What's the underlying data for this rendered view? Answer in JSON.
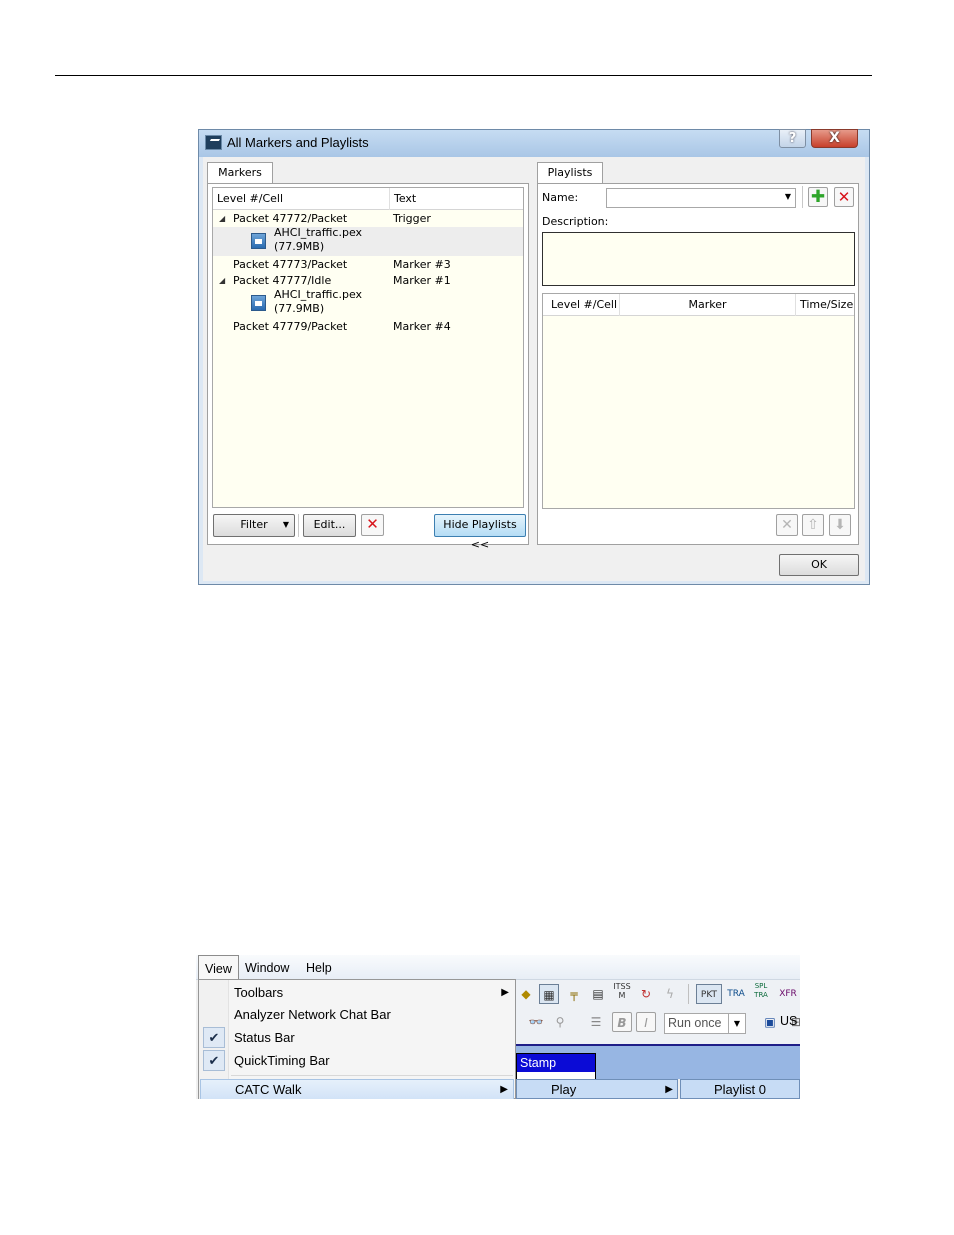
{
  "dialog": {
    "title": "All Markers and Playlists",
    "help_glyph": "?",
    "close_glyph": "X",
    "ok_label": "OK"
  },
  "markers": {
    "tab_label": "Markers",
    "columns": [
      "Level #/Cell",
      "Text"
    ],
    "rows": [
      {
        "expander": "◢",
        "cell": "Packet 47772/Packet",
        "text": "Trigger"
      },
      {
        "file_line1": "AHCI_traffic.pex",
        "file_line2": "(77.9MB)"
      },
      {
        "cell": "Packet 47773/Packet",
        "text": "Marker #3"
      },
      {
        "expander": "◢",
        "cell": "Packet 47777/Idle",
        "text": "Marker #1"
      },
      {
        "file_line1": "AHCI_traffic.pex",
        "file_line2": "(77.9MB)"
      },
      {
        "cell": "Packet 47779/Packet",
        "text": "Marker #4"
      }
    ],
    "filter_label": "Filter",
    "edit_label": "Edit...",
    "hide_playlists_label": "Hide Playlists <<"
  },
  "playlists": {
    "tab_label": "Playlists",
    "name_label": "Name:",
    "name_value": "",
    "description_label": "Description:",
    "description_value": "",
    "columns": [
      "Level #/Cell",
      "Marker",
      "Time/Size"
    ]
  },
  "menu_view": {
    "menubar": [
      "View",
      "Window",
      "Help"
    ],
    "items": [
      {
        "label": "Toolbars",
        "checked": false,
        "submenu": true
      },
      {
        "label": "Analyzer Network Chat Bar",
        "checked": false,
        "submenu": false
      },
      {
        "label": "Status Bar",
        "checked": true,
        "submenu": false
      },
      {
        "label": "QuickTiming Bar",
        "checked": true,
        "submenu": false
      },
      {
        "label": "CATC Walk",
        "checked": false,
        "submenu": true
      }
    ],
    "toolbar_labels": {
      "run_mode": "Run once",
      "pkt": "PKT",
      "tra": "TRA",
      "spl_tra": "SPL TRA",
      "xfr": "XFR",
      "itss_m": "ITSS M",
      "us": "US"
    },
    "stamp_label": "Stamp",
    "play_label": "Play",
    "playlist_label": "Playlist 0"
  }
}
